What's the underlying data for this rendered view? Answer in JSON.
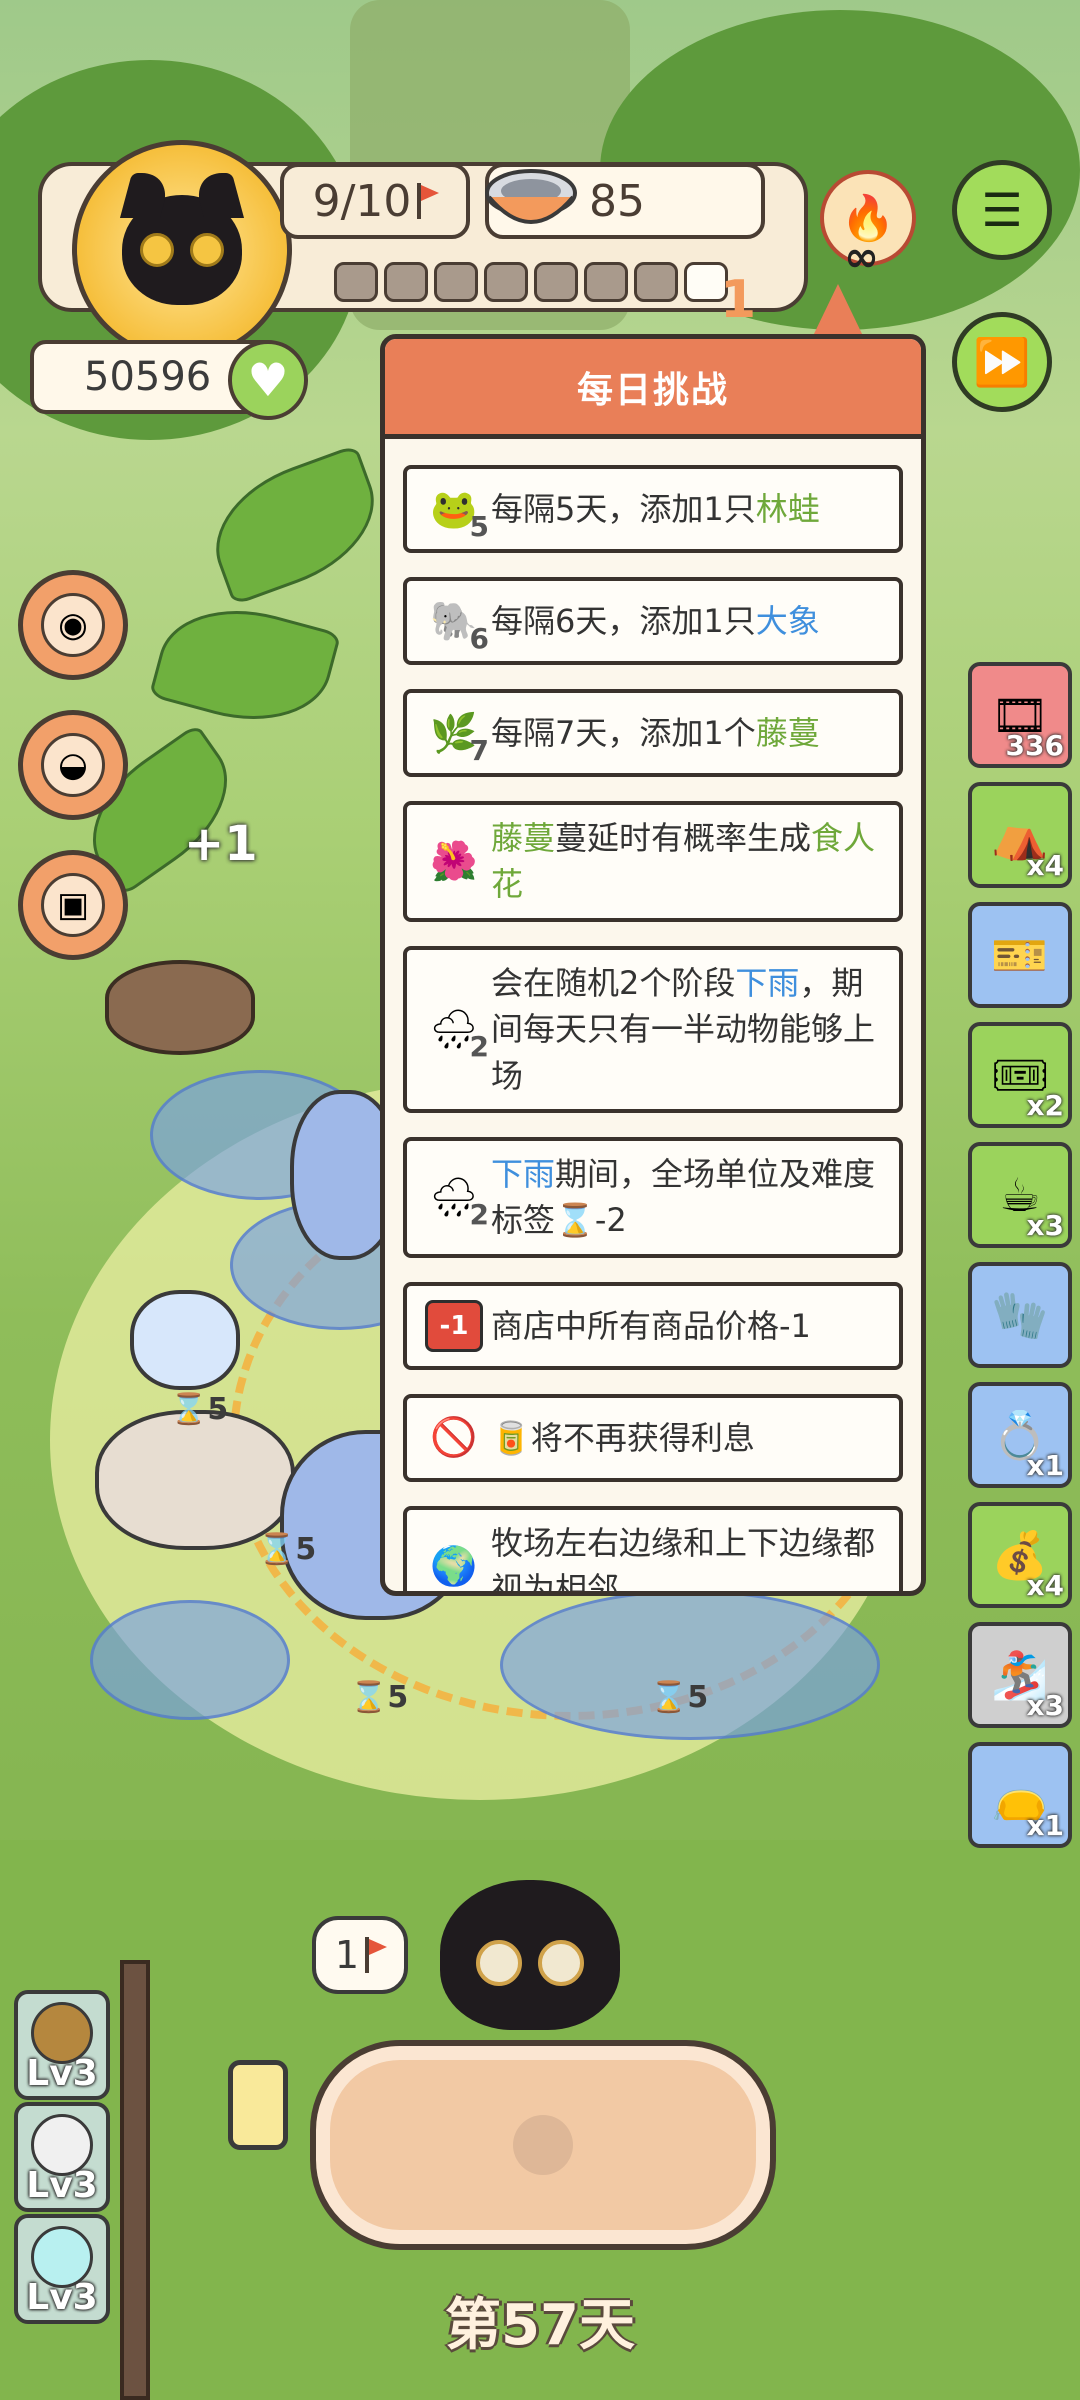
{
  "hud": {
    "flags": "9/10",
    "food": "85",
    "score": "50596",
    "progress_segments": 8,
    "progress_filled": 1,
    "badge": "1"
  },
  "popup": {
    "title": "每日挑战",
    "rules": [
      {
        "icon": "frog-icon",
        "num": "5",
        "parts": [
          {
            "t": "每隔5天，添加1只"
          },
          {
            "t": "林蛙",
            "c": "green"
          }
        ]
      },
      {
        "icon": "elephant-icon",
        "num": "6",
        "parts": [
          {
            "t": "每隔6天，添加1只"
          },
          {
            "t": "大象",
            "c": "blue"
          }
        ]
      },
      {
        "icon": "vine-icon",
        "num": "7",
        "parts": [
          {
            "t": "每隔7天，添加1个"
          },
          {
            "t": "藤蔓",
            "c": "green"
          }
        ]
      },
      {
        "icon": "flower-icon",
        "num": "",
        "parts": [
          {
            "t": "藤蔓",
            "c": "green"
          },
          {
            "t": "蔓延时有概率生成"
          },
          {
            "t": "食人花",
            "c": "green"
          }
        ]
      },
      {
        "icon": "rain-cloud-icon",
        "num": "2",
        "parts": [
          {
            "t": "会在随机2个阶段"
          },
          {
            "t": "下雨",
            "c": "blue"
          },
          {
            "t": "，期间每天只有一半动物能够上场"
          }
        ]
      },
      {
        "icon": "rain-cloud-icon",
        "num": "2",
        "parts": [
          {
            "t": "下雨",
            "c": "blue"
          },
          {
            "t": "期间，全场单位及难度标签⌛-2"
          }
        ]
      },
      {
        "icon": "discount-badge-icon",
        "num": "",
        "parts": [
          {
            "t": "商店中所有商品价格-1"
          }
        ]
      },
      {
        "icon": "no-interest-icon",
        "num": "",
        "parts": [
          {
            "t": "🥫将不再获得利息"
          }
        ]
      },
      {
        "icon": "globe-icon",
        "num": "",
        "parts": [
          {
            "t": "牧场左右边缘和上下边缘都视为相邻"
          }
        ]
      }
    ]
  },
  "inventory": [
    {
      "name": "film-reel",
      "count": "336",
      "color": "red"
    },
    {
      "name": "tent",
      "count": "x4",
      "color": "green"
    },
    {
      "name": "ticket",
      "count": "",
      "color": "blue"
    },
    {
      "name": "coupon",
      "count": "x2",
      "color": "green"
    },
    {
      "name": "coffee-cup",
      "count": "x3",
      "color": "green"
    },
    {
      "name": "mittens",
      "count": "",
      "color": "blue"
    },
    {
      "name": "ring",
      "count": "x1",
      "color": "blue"
    },
    {
      "name": "money-bag",
      "count": "x4",
      "color": "green"
    },
    {
      "name": "snowboard",
      "count": "x3",
      "color": "gray"
    },
    {
      "name": "sack",
      "count": "x1",
      "color": "blue"
    }
  ],
  "levels": [
    {
      "label": "Lv3",
      "color": "#b5873e"
    },
    {
      "label": "Lv3",
      "color": "#f0f0f0"
    },
    {
      "label": "Lv3",
      "color": "#b8f0f0"
    }
  ],
  "field": {
    "plus_one": "+1",
    "timers": [
      "5",
      "5",
      "5",
      "5"
    ]
  },
  "bottom": {
    "flag_count": "1",
    "day": "第57天"
  },
  "colors": {
    "accent": "#e97f58",
    "green": "#6fa83a",
    "blue": "#3f8fdd"
  }
}
